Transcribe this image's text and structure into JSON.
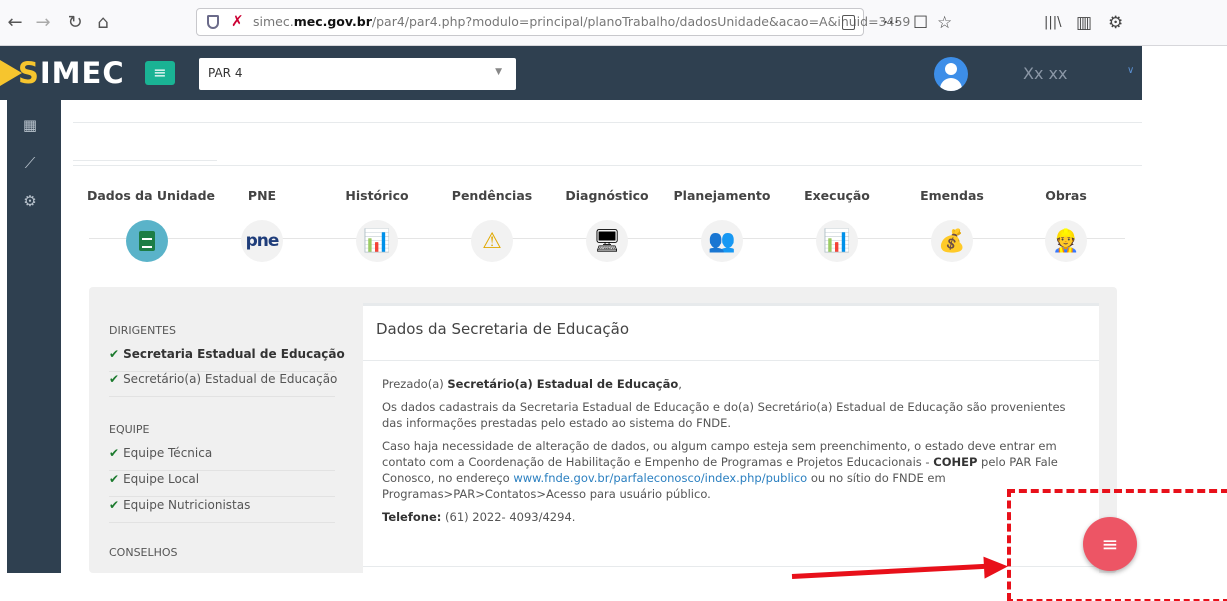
{
  "browser": {
    "url_prefix": "simec.",
    "url_domain": "mec.gov.br",
    "url_path": "/par4/par4.php?modulo=principal/planoTrabalho/dadosUnidade&acao=A&inuid=3459",
    "back_glyph": "←",
    "forward_glyph": "→",
    "reload_glyph": "↻",
    "home_glyph": "⌂",
    "more_glyph": "···",
    "pocket_glyph": "☐",
    "star_glyph": "☆",
    "library_glyph": "|||\\",
    "sidebar_glyph": "▥",
    "extension_glyph": "⚙"
  },
  "header": {
    "logo_s": "S",
    "logo_rest": "IMEC",
    "menu_glyph": "≡",
    "module": "PAR 4",
    "module_caret": "▼",
    "user_name": "Xx xx",
    "user_caret": "∨"
  },
  "sidebar": {
    "icons": [
      "grid-icon",
      "chart-line-icon",
      "cogs-icon"
    ],
    "glyphs": [
      "▦",
      "⟋",
      "⚙"
    ]
  },
  "steps": [
    {
      "label": "Dados da Unidade",
      "icon": "document-icon"
    },
    {
      "label": "PNE",
      "icon": "pne-logo-icon",
      "glyph": "pne"
    },
    {
      "label": "Histórico",
      "icon": "history-chart-icon",
      "glyph": "📊"
    },
    {
      "label": "Pendências",
      "icon": "warning-icon",
      "glyph": "⚠"
    },
    {
      "label": "Diagnóstico",
      "icon": "presentation-icon",
      "glyph": "🖥"
    },
    {
      "label": "Planejamento",
      "icon": "planning-icon",
      "glyph": "👥"
    },
    {
      "label": "Execução",
      "icon": "execution-chart-icon",
      "glyph": "📊"
    },
    {
      "label": "Emendas",
      "icon": "coins-icon",
      "glyph": "💰"
    },
    {
      "label": "Obras",
      "icon": "worker-icon",
      "glyph": "👷"
    }
  ],
  "left_menu": {
    "dirigentes_header": "DIRIGENTES",
    "dirigentes": [
      "Secretaria Estadual de Educação",
      "Secretário(a) Estadual de Educação"
    ],
    "equipe_header": "EQUIPE",
    "equipe": [
      "Equipe Técnica",
      "Equipe Local",
      "Equipe Nutricionistas"
    ],
    "conselhos_header": "CONSELHOS",
    "check_glyph": "✔"
  },
  "card": {
    "title": "Dados da Secretaria de Educação",
    "greeting_prefix": "Prezado(a) ",
    "greeting_name": "Secretário(a) Estadual de Educação",
    "greeting_suffix": ",",
    "para1": "Os dados cadastrais da Secretaria Estadual de Educação e do(a) Secretário(a) Estadual de Educação são provenientes das informações prestadas pelo estado ao sistema do FNDE.",
    "para2_a": "Caso haja necessidade de alteração de dados, ou algum campo esteja sem preenchimento, o estado deve entrar em contato com a Coordenação de Habilitação e Empenho de Programas e Projetos Educacionais - ",
    "para2_cohep": "COHEP",
    "para2_b": " pelo PAR Fale Conosco, no endereço ",
    "para2_link": "www.fnde.gov.br/parfaleconosco/index.php/publico",
    "para2_c": " ou no sítio do FNDE em Programas>PAR>Contatos>Acesso para usuário público.",
    "phone_label": "Telefone:",
    "phone_value": " (61) 2022- 4093/4294."
  },
  "fab": {
    "glyph": "≡"
  },
  "colors": {
    "header_bg": "#2f4050",
    "accent_green": "#1ab394",
    "logo_yellow": "#f6c52e",
    "fab_red": "#ed5565",
    "annotation_red": "#e8101a"
  }
}
